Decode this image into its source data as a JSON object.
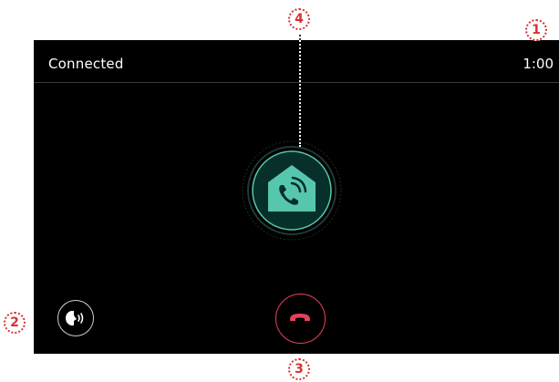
{
  "status_bar": {
    "call_status": "Connected",
    "call_timer": "1:00"
  },
  "caller": {
    "icon": "home-phone-icon",
    "accent_color": "#56c7ad"
  },
  "controls": {
    "voice_icon": "voice-speaker-icon",
    "end_call_icon": "end-call-icon",
    "end_call_color": "#e8405a"
  },
  "callouts": {
    "timer": "1",
    "voice_button": "2",
    "end_call": "3",
    "caller_icon": "4"
  }
}
